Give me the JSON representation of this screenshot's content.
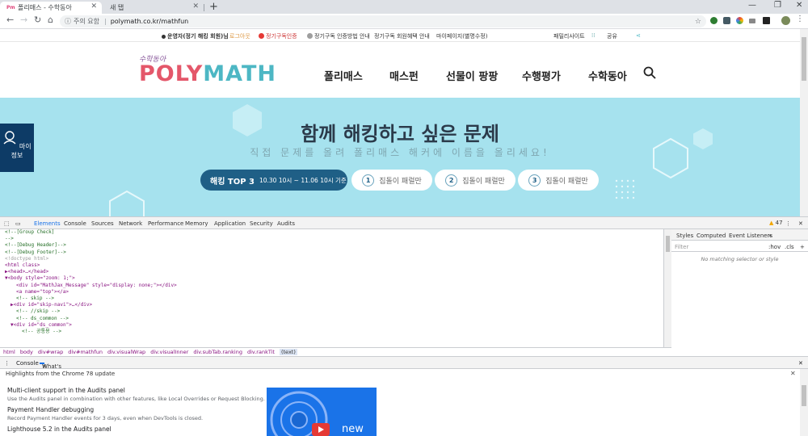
{
  "browser": {
    "tabs": [
      {
        "favicon": "Pm",
        "title": "폴리매스 - 수학동아"
      },
      {
        "title": "새 탭"
      }
    ],
    "address": {
      "security_label": "주의 요함",
      "url": "polymath.co.kr/mathfun"
    }
  },
  "site": {
    "util_links": [
      "운영자(정기 해킹 회원)님",
      "로그아웃",
      "정기구독인증",
      "정기구독 인증방법 안내",
      "정기구독 회원혜택 안내",
      "마이페이지(별명수정)",
      "패밀리사이트",
      "공유"
    ],
    "logo": {
      "tagline": "수학동아",
      "word_left": "POLY",
      "word_right": "MATH"
    },
    "nav": [
      "폴리매스",
      "매스펀",
      "선물이 팡팡",
      "수행평가",
      "수학동아"
    ],
    "hero": {
      "title": "함께 해킹하고 싶은 문제",
      "subtitle": "직접 문제를 올려 폴리매스 해커에 이름을 올리세요!",
      "rank_title": "해킹 TOP 3",
      "rank_period": "10.30 10시 ~ 11.06 10시 기준",
      "ranks": [
        {
          "num": "1",
          "name": "집돌이 패럴만"
        },
        {
          "num": "2",
          "name": "집돌이 패럴만"
        },
        {
          "num": "3",
          "name": "집돌이 패럴만"
        }
      ]
    },
    "side_button": "마이정보"
  },
  "devtools": {
    "tabs": [
      "Elements",
      "Console",
      "Sources",
      "Network",
      "Performance",
      "Memory",
      "Application",
      "Security",
      "Audits"
    ],
    "warnings": "47",
    "dom_lines": [
      {
        "t": "c",
        "i": 0,
        "s": "<!--[Group Check]"
      },
      {
        "t": "c",
        "i": 0,
        "s": ""
      },
      {
        "t": "c",
        "i": 0,
        "s": "-->"
      },
      {
        "t": "c",
        "i": 0,
        "s": "<!--[Debug Header]-->"
      },
      {
        "t": "c",
        "i": 0,
        "s": "<!--[Debug Footer]-->"
      },
      {
        "t": "g",
        "i": 0,
        "s": "<!doctype html>"
      },
      {
        "t": "tag",
        "i": 0,
        "s": "<html class>"
      },
      {
        "t": "tag",
        "i": 0,
        "s": "▶<head>…</head>"
      },
      {
        "t": "tag",
        "i": 0,
        "s": "▼<body style=\"zoom: 1;\">"
      },
      {
        "t": "tag",
        "i": 2,
        "s": "<div id=\"MathJax_Message\" style=\"display: none;\"></div>"
      },
      {
        "t": "tag",
        "i": 2,
        "s": "<a name=\"top\"></a>"
      },
      {
        "t": "c",
        "i": 2,
        "s": "<!-- skip -->"
      },
      {
        "t": "tag",
        "i": 1,
        "s": "▶<div id=\"skip-navi\">…</div>"
      },
      {
        "t": "c",
        "i": 2,
        "s": "<!-- //skip -->"
      },
      {
        "t": "c",
        "i": 2,
        "s": "<!-- ds_common -->"
      },
      {
        "t": "tag",
        "i": 1,
        "s": "▼<div id=\"ds_common\">"
      },
      {
        "t": "c",
        "i": 3,
        "s": "<!-- 공통용 -->"
      }
    ],
    "styles_tabs": [
      "Styles",
      "Computed",
      "Event Listeners"
    ],
    "filter_placeholder": "Filter",
    "filter_hov": ":hov",
    "filter_cls": ".cls",
    "no_match": "No matching selector or style",
    "breadcrumbs": [
      "html",
      "body",
      "div#wrap",
      "div#mathfun",
      "div.visualWrap",
      "div.visualInner",
      "div.subTab.ranking",
      "div.rankTit",
      "(text)"
    ],
    "drawer_tabs": [
      "Console",
      "What's New"
    ],
    "whats_new": {
      "header": "Highlights from the Chrome 78 update",
      "items": [
        {
          "title": "Multi-client support in the Audits panel",
          "desc": "Use the Audits panel in combination with other features, like Local Overrides or Request Blocking."
        },
        {
          "title": "Payment Handler debugging",
          "desc": "Record Payment Handler events for 3 days, even when DevTools is closed."
        },
        {
          "title": "Lighthouse 5.2 in the Audits panel",
          "desc": ""
        }
      ],
      "video_label": "new"
    }
  },
  "colors": {
    "brand_pink": "#e4576a",
    "brand_teal": "#4db7c4",
    "hero_bg": "#a6e2ee",
    "rank_pill": "#1f5f86",
    "devtools_accent": "#1a73e8"
  }
}
